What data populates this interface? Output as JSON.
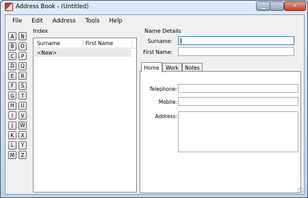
{
  "window": {
    "title": "Address Book - (Untitled)",
    "controls": {
      "minimize_icon": "minimize-icon",
      "maximize_icon": "maximize-icon",
      "close_icon": "close-icon"
    }
  },
  "menu": {
    "items": [
      {
        "label": "File"
      },
      {
        "label": "Edit"
      },
      {
        "label": "Address"
      },
      {
        "label": "Tools"
      },
      {
        "label": "Help"
      }
    ]
  },
  "alphabet": [
    "A",
    "N",
    "B",
    "O",
    "C",
    "P",
    "D",
    "Q",
    "E",
    "R",
    "F",
    "S",
    "G",
    "T",
    "H",
    "U",
    "I",
    "V",
    "J",
    "W",
    "K",
    "X",
    "L",
    "Y",
    "M",
    "Z"
  ],
  "index": {
    "label": "Index",
    "columns": [
      "Surname",
      "First Name"
    ],
    "rows": [
      {
        "surname": "<New>",
        "first_name": ""
      }
    ]
  },
  "name_details": {
    "label": "Name Details",
    "surname_label": "Surname:",
    "surname_value": "",
    "first_name_label": "First Name:",
    "first_name_value": ""
  },
  "tabs": [
    {
      "label": "Home",
      "selected": true
    },
    {
      "label": "Work",
      "selected": false
    },
    {
      "label": "Notes",
      "selected": false
    }
  ],
  "home": {
    "telephone_label": "Telephone:",
    "mobile_label": "Mobile:",
    "address_label": "Address:"
  }
}
